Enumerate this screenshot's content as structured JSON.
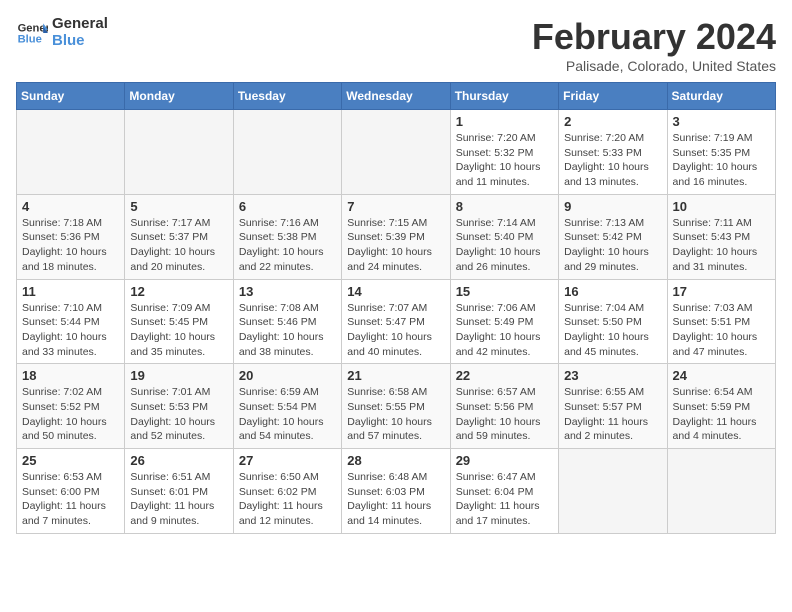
{
  "logo": {
    "line1": "General",
    "line2": "Blue"
  },
  "title": "February 2024",
  "subtitle": "Palisade, Colorado, United States",
  "days_of_week": [
    "Sunday",
    "Monday",
    "Tuesday",
    "Wednesday",
    "Thursday",
    "Friday",
    "Saturday"
  ],
  "weeks": [
    [
      {
        "day": "",
        "info": ""
      },
      {
        "day": "",
        "info": ""
      },
      {
        "day": "",
        "info": ""
      },
      {
        "day": "",
        "info": ""
      },
      {
        "day": "1",
        "info": "Sunrise: 7:20 AM\nSunset: 5:32 PM\nDaylight: 10 hours\nand 11 minutes."
      },
      {
        "day": "2",
        "info": "Sunrise: 7:20 AM\nSunset: 5:33 PM\nDaylight: 10 hours\nand 13 minutes."
      },
      {
        "day": "3",
        "info": "Sunrise: 7:19 AM\nSunset: 5:35 PM\nDaylight: 10 hours\nand 16 minutes."
      }
    ],
    [
      {
        "day": "4",
        "info": "Sunrise: 7:18 AM\nSunset: 5:36 PM\nDaylight: 10 hours\nand 18 minutes."
      },
      {
        "day": "5",
        "info": "Sunrise: 7:17 AM\nSunset: 5:37 PM\nDaylight: 10 hours\nand 20 minutes."
      },
      {
        "day": "6",
        "info": "Sunrise: 7:16 AM\nSunset: 5:38 PM\nDaylight: 10 hours\nand 22 minutes."
      },
      {
        "day": "7",
        "info": "Sunrise: 7:15 AM\nSunset: 5:39 PM\nDaylight: 10 hours\nand 24 minutes."
      },
      {
        "day": "8",
        "info": "Sunrise: 7:14 AM\nSunset: 5:40 PM\nDaylight: 10 hours\nand 26 minutes."
      },
      {
        "day": "9",
        "info": "Sunrise: 7:13 AM\nSunset: 5:42 PM\nDaylight: 10 hours\nand 29 minutes."
      },
      {
        "day": "10",
        "info": "Sunrise: 7:11 AM\nSunset: 5:43 PM\nDaylight: 10 hours\nand 31 minutes."
      }
    ],
    [
      {
        "day": "11",
        "info": "Sunrise: 7:10 AM\nSunset: 5:44 PM\nDaylight: 10 hours\nand 33 minutes."
      },
      {
        "day": "12",
        "info": "Sunrise: 7:09 AM\nSunset: 5:45 PM\nDaylight: 10 hours\nand 35 minutes."
      },
      {
        "day": "13",
        "info": "Sunrise: 7:08 AM\nSunset: 5:46 PM\nDaylight: 10 hours\nand 38 minutes."
      },
      {
        "day": "14",
        "info": "Sunrise: 7:07 AM\nSunset: 5:47 PM\nDaylight: 10 hours\nand 40 minutes."
      },
      {
        "day": "15",
        "info": "Sunrise: 7:06 AM\nSunset: 5:49 PM\nDaylight: 10 hours\nand 42 minutes."
      },
      {
        "day": "16",
        "info": "Sunrise: 7:04 AM\nSunset: 5:50 PM\nDaylight: 10 hours\nand 45 minutes."
      },
      {
        "day": "17",
        "info": "Sunrise: 7:03 AM\nSunset: 5:51 PM\nDaylight: 10 hours\nand 47 minutes."
      }
    ],
    [
      {
        "day": "18",
        "info": "Sunrise: 7:02 AM\nSunset: 5:52 PM\nDaylight: 10 hours\nand 50 minutes."
      },
      {
        "day": "19",
        "info": "Sunrise: 7:01 AM\nSunset: 5:53 PM\nDaylight: 10 hours\nand 52 minutes."
      },
      {
        "day": "20",
        "info": "Sunrise: 6:59 AM\nSunset: 5:54 PM\nDaylight: 10 hours\nand 54 minutes."
      },
      {
        "day": "21",
        "info": "Sunrise: 6:58 AM\nSunset: 5:55 PM\nDaylight: 10 hours\nand 57 minutes."
      },
      {
        "day": "22",
        "info": "Sunrise: 6:57 AM\nSunset: 5:56 PM\nDaylight: 10 hours\nand 59 minutes."
      },
      {
        "day": "23",
        "info": "Sunrise: 6:55 AM\nSunset: 5:57 PM\nDaylight: 11 hours\nand 2 minutes."
      },
      {
        "day": "24",
        "info": "Sunrise: 6:54 AM\nSunset: 5:59 PM\nDaylight: 11 hours\nand 4 minutes."
      }
    ],
    [
      {
        "day": "25",
        "info": "Sunrise: 6:53 AM\nSunset: 6:00 PM\nDaylight: 11 hours\nand 7 minutes."
      },
      {
        "day": "26",
        "info": "Sunrise: 6:51 AM\nSunset: 6:01 PM\nDaylight: 11 hours\nand 9 minutes."
      },
      {
        "day": "27",
        "info": "Sunrise: 6:50 AM\nSunset: 6:02 PM\nDaylight: 11 hours\nand 12 minutes."
      },
      {
        "day": "28",
        "info": "Sunrise: 6:48 AM\nSunset: 6:03 PM\nDaylight: 11 hours\nand 14 minutes."
      },
      {
        "day": "29",
        "info": "Sunrise: 6:47 AM\nSunset: 6:04 PM\nDaylight: 11 hours\nand 17 minutes."
      },
      {
        "day": "",
        "info": ""
      },
      {
        "day": "",
        "info": ""
      }
    ]
  ]
}
